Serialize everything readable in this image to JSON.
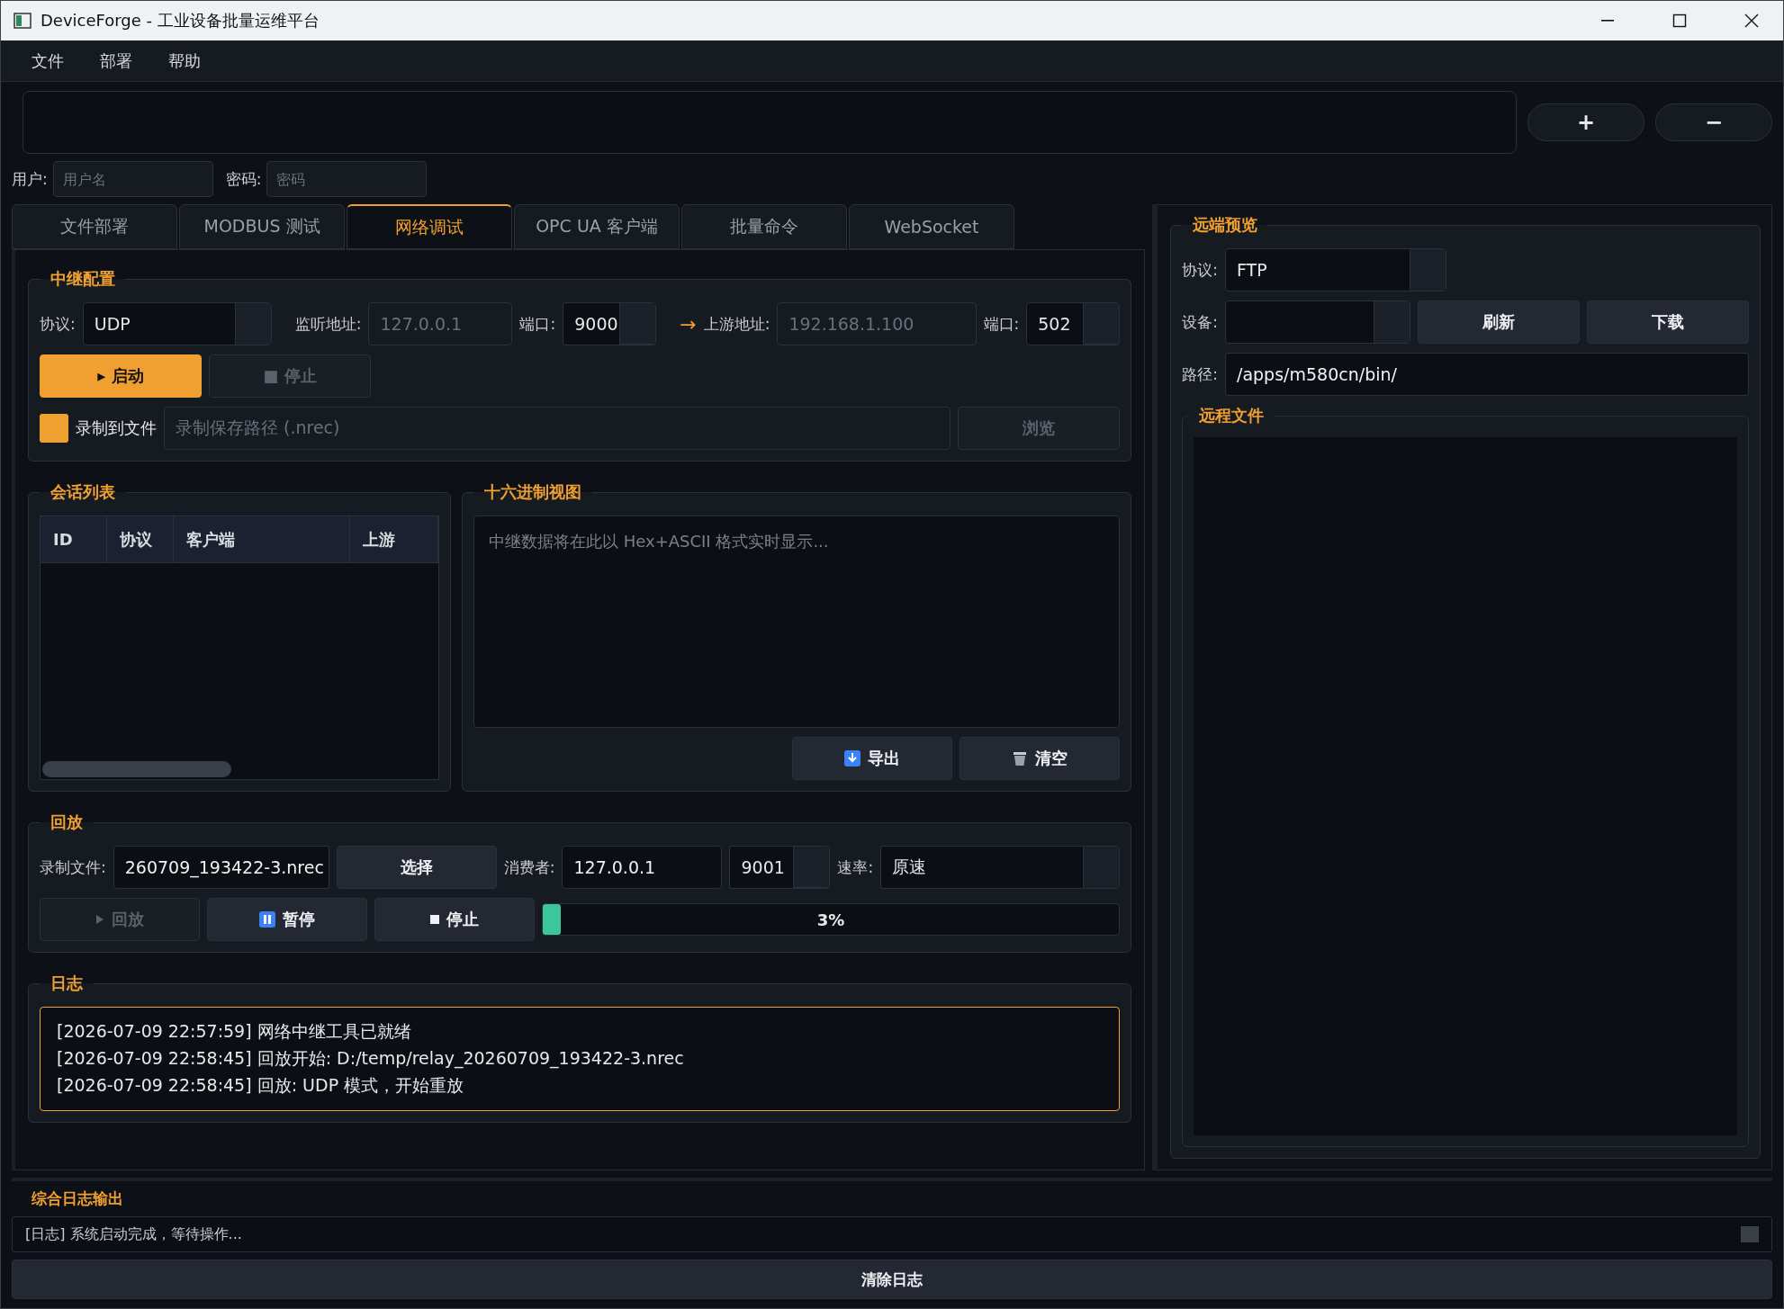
{
  "window": {
    "title": "DeviceForge - 工业设备批量运维平台"
  },
  "menu": [
    "文件",
    "部署",
    "帮助"
  ],
  "toolbar": {
    "buttons": [
      "+",
      "−"
    ]
  },
  "login": {
    "user_label": "用户:",
    "user_placeholder": "用户名",
    "pass_label": "密码:",
    "pass_placeholder": "密码"
  },
  "tabs": [
    {
      "label": "文件部署",
      "selected": false
    },
    {
      "label": "MODBUS 测试",
      "selected": false
    },
    {
      "label": "网络调试",
      "selected": true
    },
    {
      "label": "OPC UA 客户端",
      "selected": false
    },
    {
      "label": "批量命令",
      "selected": false
    },
    {
      "label": "WebSocket",
      "selected": false
    }
  ],
  "relay": {
    "title": "中继配置",
    "protocol_label": "协议:",
    "protocol": "UDP",
    "listen_label": "监听地址:",
    "listen_placeholder": "127.0.0.1",
    "port_label": "端口:",
    "port": "9000",
    "arrow": "→",
    "upstream_label": "上游地址:",
    "upstream_placeholder": "192.168.1.100",
    "upstream_port_label": "端口:",
    "upstream_port": "502",
    "buttons": [
      {
        "label": "▸ 启动",
        "kind": "primary",
        "disabled": false
      },
      {
        "label": "■ 停止",
        "kind": "normal",
        "disabled": true
      }
    ],
    "record": {
      "checked": true,
      "label": "录制到文件",
      "placeholder": "录制保存路径 (.nrec)",
      "browse": {
        "label": "浏览",
        "disabled": true
      }
    }
  },
  "sessions": {
    "title": "会话列表",
    "columns": [
      "ID",
      "协议",
      "客户端",
      "上游"
    ]
  },
  "hex": {
    "title": "十六进制视图",
    "placeholder": "中继数据将在此以 Hex+ASCII 格式实时显示...",
    "buttons": [
      {
        "label": "导出",
        "kind": "export"
      },
      {
        "label": "清空",
        "kind": "clear"
      }
    ]
  },
  "playback": {
    "title": "回放",
    "file_label": "录制文件:",
    "file": "260709_193422-3.nrec",
    "choose": "选择",
    "consumer_label": "消费者:",
    "consumer": "127.0.0.1",
    "port": "9001",
    "rate_label": "速率:",
    "rate": "原速",
    "buttons": [
      {
        "label": "回放",
        "kind": "play",
        "disabled": true
      },
      {
        "label": "暂停",
        "kind": "pause",
        "disabled": false
      },
      {
        "label": "停止",
        "kind": "stop",
        "disabled": false
      }
    ],
    "progress": {
      "level": 0.03,
      "reading": "3%"
    }
  },
  "log": {
    "title": "日志",
    "lines": [
      "[2026-07-09 22:57:59] 网络中继工具已就绪",
      "[2026-07-09 22:58:45] 回放开始: D:/temp/relay_20260709_193422-3.nrec",
      "[2026-07-09 22:58:45] 回放: UDP 模式，开始重放"
    ]
  },
  "remote": {
    "title": "远端预览",
    "protocol_label": "协议:",
    "protocol": "FTP",
    "device_label": "设备:",
    "buttons": [
      "刷新",
      "下载"
    ],
    "path_label": "路径:",
    "path": "/apps/m580cn/bin/",
    "files_title": "远程文件"
  },
  "combined_log": {
    "title": "综合日志输出",
    "line": "[日志] 系统启动完成，等待操作...",
    "clear": "清除日志"
  }
}
